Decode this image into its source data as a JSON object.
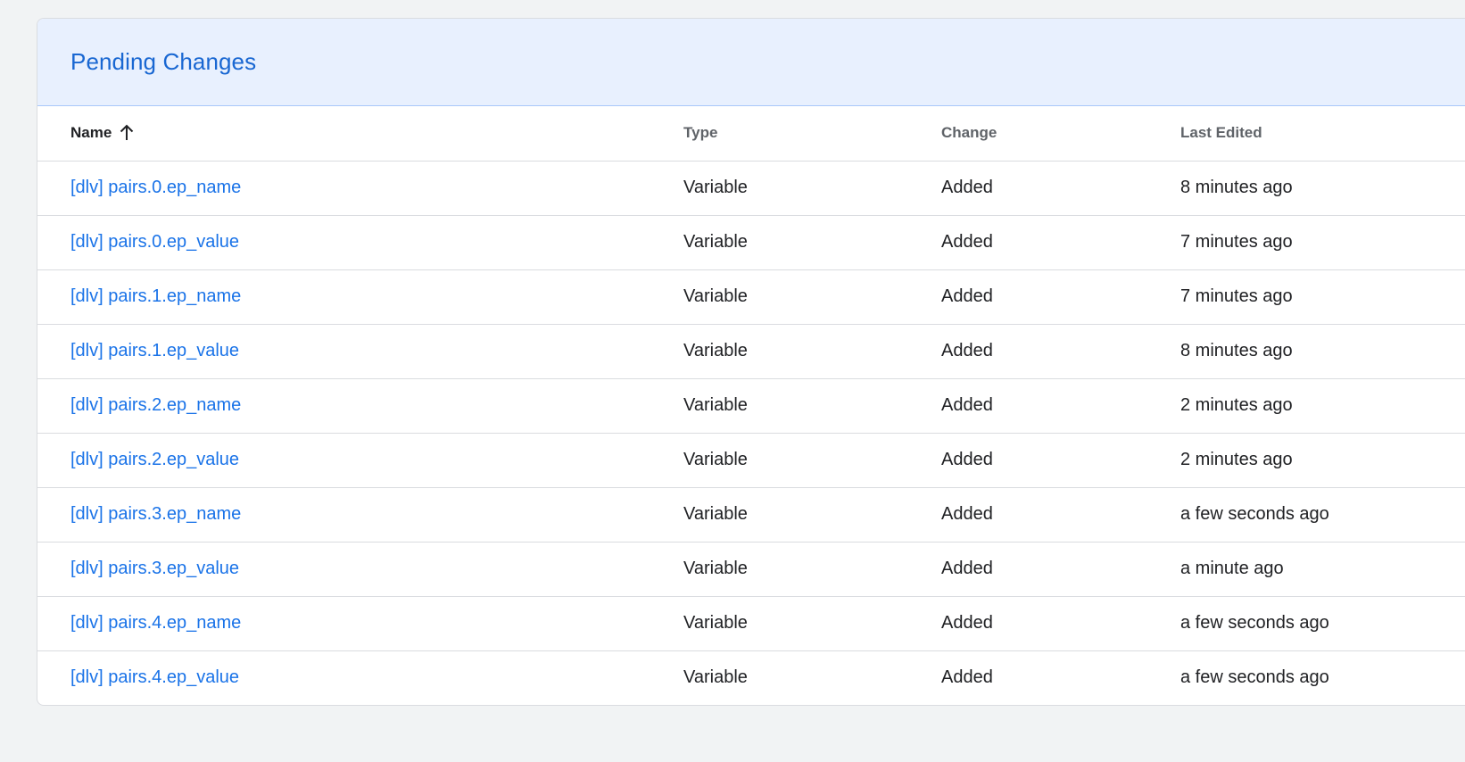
{
  "card": {
    "title": "Pending Changes"
  },
  "table": {
    "headers": {
      "name": "Name",
      "type": "Type",
      "change": "Change",
      "last_edited": "Last Edited"
    },
    "sort_icon": "arrow-upward-icon",
    "rows": [
      {
        "name": "[dlv] pairs.0.ep_name",
        "type": "Variable",
        "change": "Added",
        "last_edited": "8 minutes ago"
      },
      {
        "name": "[dlv] pairs.0.ep_value",
        "type": "Variable",
        "change": "Added",
        "last_edited": "7 minutes ago"
      },
      {
        "name": "[dlv] pairs.1.ep_name",
        "type": "Variable",
        "change": "Added",
        "last_edited": "7 minutes ago"
      },
      {
        "name": "[dlv] pairs.1.ep_value",
        "type": "Variable",
        "change": "Added",
        "last_edited": "8 minutes ago"
      },
      {
        "name": "[dlv] pairs.2.ep_name",
        "type": "Variable",
        "change": "Added",
        "last_edited": "2 minutes ago"
      },
      {
        "name": "[dlv] pairs.2.ep_value",
        "type": "Variable",
        "change": "Added",
        "last_edited": "2 minutes ago"
      },
      {
        "name": "[dlv] pairs.3.ep_name",
        "type": "Variable",
        "change": "Added",
        "last_edited": "a few seconds ago"
      },
      {
        "name": "[dlv] pairs.3.ep_value",
        "type": "Variable",
        "change": "Added",
        "last_edited": "a minute ago"
      },
      {
        "name": "[dlv] pairs.4.ep_name",
        "type": "Variable",
        "change": "Added",
        "last_edited": "a few seconds ago"
      },
      {
        "name": "[dlv] pairs.4.ep_value",
        "type": "Variable",
        "change": "Added",
        "last_edited": "a few seconds ago"
      }
    ]
  },
  "colors": {
    "header_bg": "#e8f0fe",
    "title": "#1967d2",
    "link": "#1a73e8",
    "page_bg": "#f1f3f4"
  }
}
